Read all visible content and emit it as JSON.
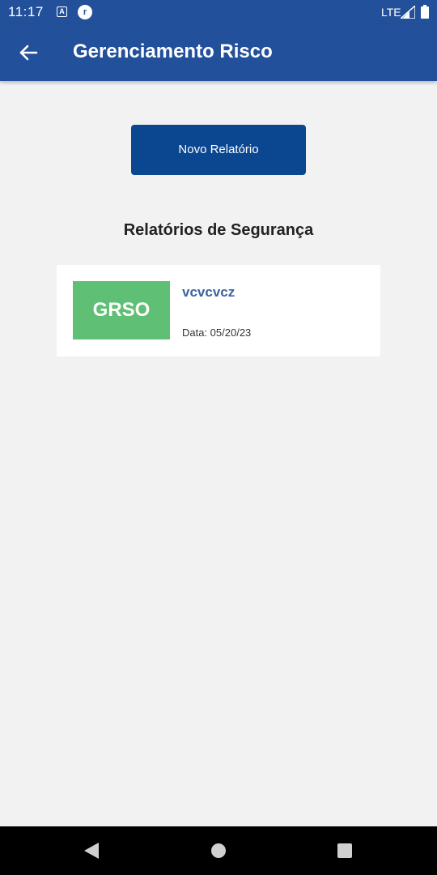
{
  "status_bar": {
    "time": "11:17",
    "notification_icon_1": "A",
    "notification_icon_2": "r",
    "network": "LTE",
    "background_color": "#23509a"
  },
  "app_bar": {
    "title": "Gerenciamento Risco",
    "back_icon": "arrow-left-icon",
    "background_color": "#23509a"
  },
  "main": {
    "new_report_button": "Novo Relatório",
    "section_title": "Relatórios de Segurança",
    "reports": [
      {
        "badge": "GRSO",
        "badge_color": "#5fbf75",
        "name": "vcvcvcz",
        "date": "Data: 05/20/23"
      }
    ]
  },
  "nav_bar": {
    "icons": [
      "triangle-back-icon",
      "circle-home-icon",
      "square-recents-icon"
    ]
  }
}
